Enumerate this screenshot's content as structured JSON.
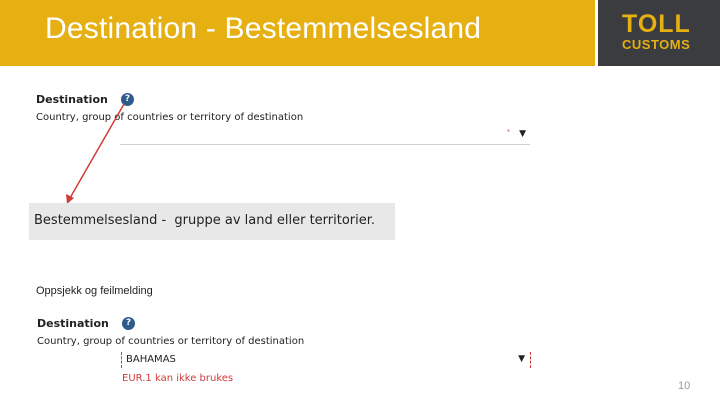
{
  "header": {
    "title": "Destination - Bestemmelsesland",
    "logo": {
      "line1": "TOLL",
      "line2": "CUSTOMS"
    }
  },
  "form_top": {
    "section_title": "Destination",
    "help_icon": "?",
    "field_description": "Country, group of countries or territory of destination",
    "select_value": "",
    "required_marker": "*",
    "arrow": "▼"
  },
  "translation": {
    "text": "Bestemmelsesland -  gruppe av land eller territorier."
  },
  "caption": "Oppsjekk og feilmelding",
  "form_bottom": {
    "section_title": "Destination",
    "help_icon": "?",
    "field_description": "Country, group of countries or territory of destination",
    "select_value": "BAHAMAS",
    "arrow": "▼",
    "error_message": "EUR.1 kan ikke brukes"
  },
  "page_number": "10",
  "colors": {
    "header_bg": "#e6b012",
    "logo_bg": "#3a3c40",
    "help_icon": "#2f5a8c",
    "error": "#d23b3b",
    "arrow": "#d23b3b"
  }
}
